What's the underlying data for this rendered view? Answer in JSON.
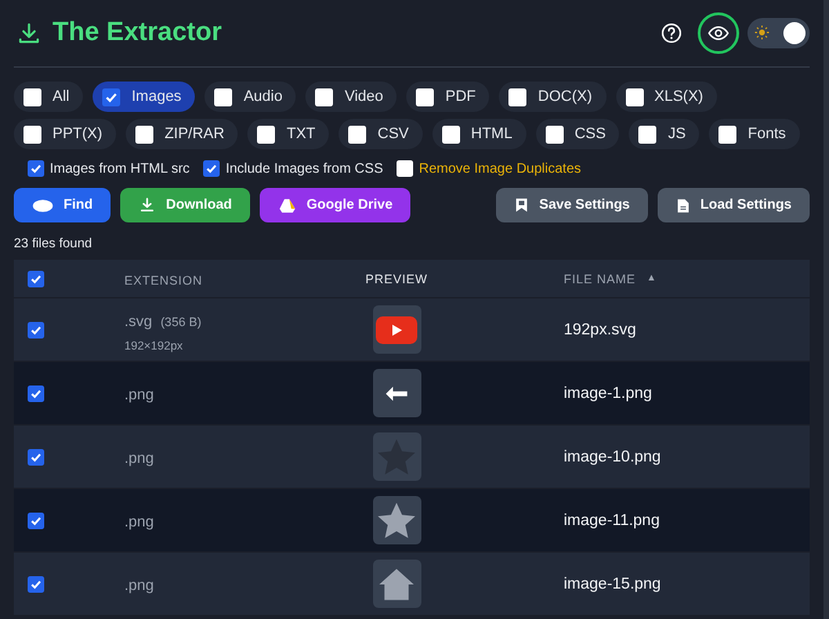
{
  "header": {
    "title": "The Extractor",
    "theme_toggle": {
      "on": true
    }
  },
  "filters": [
    {
      "label": "All",
      "checked": false
    },
    {
      "label": "Images",
      "checked": true
    },
    {
      "label": "Audio",
      "checked": false
    },
    {
      "label": "Video",
      "checked": false
    },
    {
      "label": "PDF",
      "checked": false
    },
    {
      "label": "DOC(X)",
      "checked": false
    },
    {
      "label": "XLS(X)",
      "checked": false
    },
    {
      "label": "PPT(X)",
      "checked": false
    },
    {
      "label": "ZIP/RAR",
      "checked": false
    },
    {
      "label": "TXT",
      "checked": false
    },
    {
      "label": "CSV",
      "checked": false
    },
    {
      "label": "HTML",
      "checked": false
    },
    {
      "label": "CSS",
      "checked": false
    },
    {
      "label": "JS",
      "checked": false
    },
    {
      "label": "Fonts",
      "checked": false
    }
  ],
  "options": [
    {
      "label": "Images from HTML src",
      "checked": true,
      "kind": "normal"
    },
    {
      "label": "Include Images from CSS",
      "checked": true,
      "kind": "normal"
    },
    {
      "label": "Remove Image Duplicates",
      "checked": false,
      "kind": "warning"
    }
  ],
  "actions": [
    {
      "label": "Find",
      "kind": "find"
    },
    {
      "label": "Download",
      "kind": "download"
    },
    {
      "label": "Google Drive",
      "kind": "drive"
    }
  ],
  "settings_buttons": [
    {
      "label": "Save Settings",
      "kind": "save"
    },
    {
      "label": "Load Settings",
      "kind": "load"
    }
  ],
  "count": "23 files found",
  "table": {
    "all_checked": true,
    "columns": [
      "EXTENSION",
      "PREVIEW",
      "FILE NAME"
    ],
    "sort_indicator": "▲",
    "rows": [
      {
        "checked": true,
        "extension": ".svg",
        "size": "(356 B)",
        "dimensions": "192×192px",
        "kind": "youtube",
        "file_name": "192px.svg"
      },
      {
        "checked": true,
        "extension": ".png",
        "kind": "arrow",
        "file_name": "image-1.png"
      },
      {
        "checked": true,
        "extension": ".png",
        "kind": "star-dark",
        "file_name": "image-10.png"
      },
      {
        "checked": true,
        "extension": ".png",
        "kind": "star-light",
        "file_name": "image-11.png"
      },
      {
        "checked": true,
        "extension": ".png",
        "kind": "house",
        "file_name": "image-15.png"
      }
    ]
  }
}
